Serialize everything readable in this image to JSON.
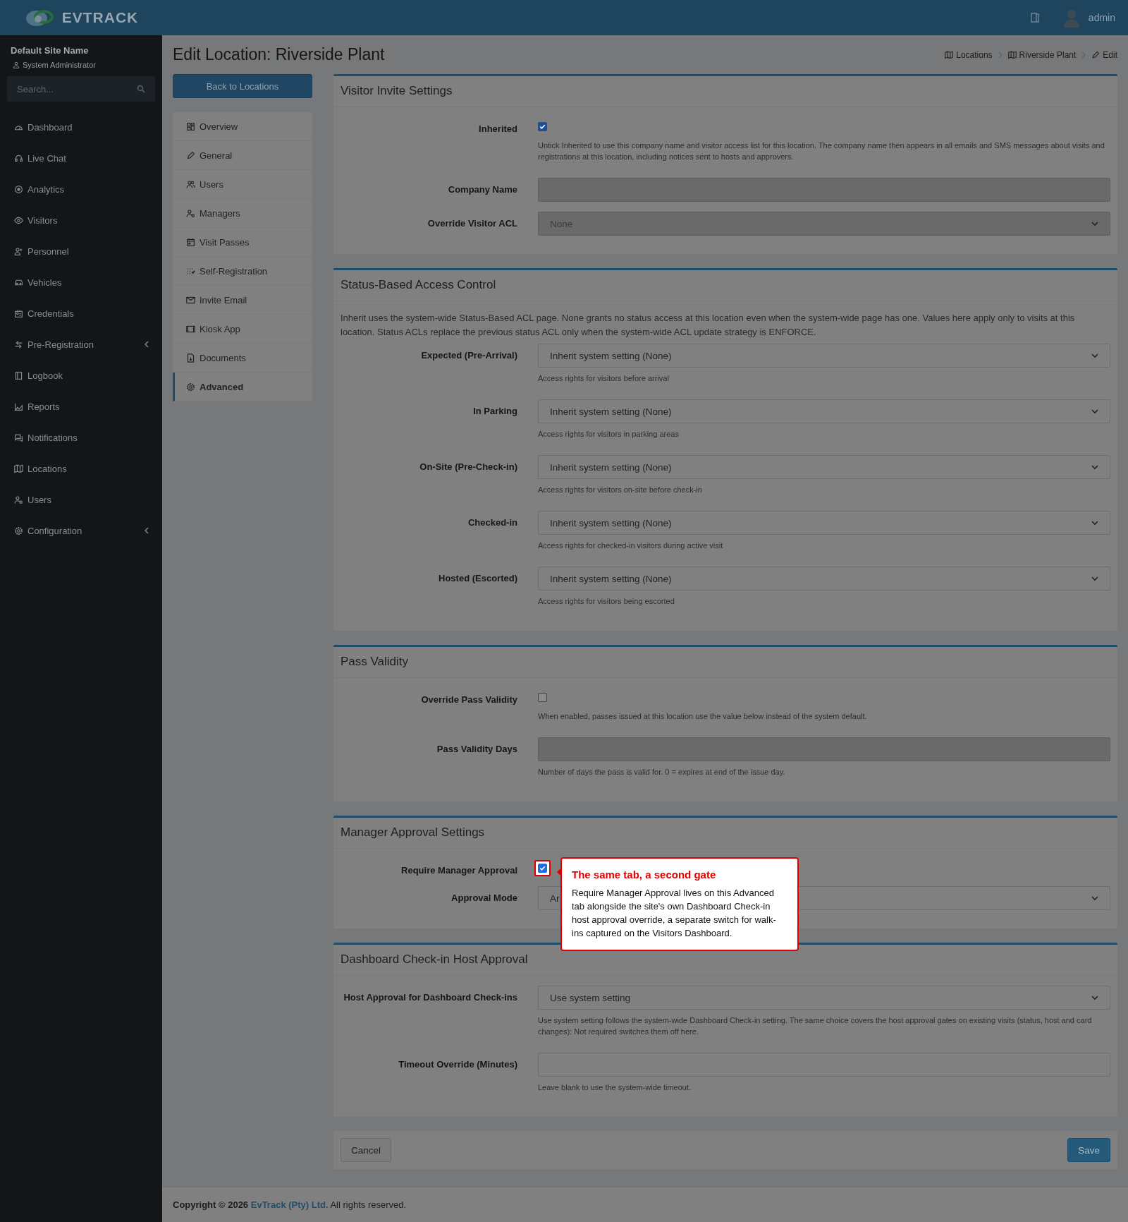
{
  "header": {
    "brand": "EVTRACK",
    "user": "admin"
  },
  "sidebar": {
    "site": "Default Site Name",
    "role": "System Administrator",
    "search": {
      "placeholder": "Search..."
    },
    "items": [
      {
        "label": "Dashboard",
        "has_submenu": false
      },
      {
        "label": "Live Chat",
        "has_submenu": false
      },
      {
        "label": "Analytics",
        "has_submenu": false
      },
      {
        "label": "Visitors",
        "has_submenu": false
      },
      {
        "label": "Personnel",
        "has_submenu": false
      },
      {
        "label": "Vehicles",
        "has_submenu": false
      },
      {
        "label": "Credentials",
        "has_submenu": false
      },
      {
        "label": "Pre-Registration",
        "has_submenu": true
      },
      {
        "label": "Logbook",
        "has_submenu": false
      },
      {
        "label": "Reports",
        "has_submenu": false
      },
      {
        "label": "Notifications",
        "has_submenu": false
      },
      {
        "label": "Locations",
        "has_submenu": false
      },
      {
        "label": "Users",
        "has_submenu": false
      },
      {
        "label": "Configuration",
        "has_submenu": true
      }
    ]
  },
  "page": {
    "title": "Edit Location: Riverside Plant",
    "breadcrumb": [
      "Locations",
      "Riverside Plant",
      "Edit"
    ]
  },
  "back_button": "Back to Locations",
  "tabs": [
    {
      "label": "Overview",
      "selected": false
    },
    {
      "label": "General",
      "selected": false
    },
    {
      "label": "Users",
      "selected": false
    },
    {
      "label": "Managers",
      "selected": false
    },
    {
      "label": "Visit Passes",
      "selected": false
    },
    {
      "label": "Self-Registration",
      "selected": false
    },
    {
      "label": "Invite Email",
      "selected": false
    },
    {
      "label": "Kiosk App",
      "selected": false
    },
    {
      "label": "Documents",
      "selected": false
    },
    {
      "label": "Advanced",
      "selected": true
    }
  ],
  "sections": [
    {
      "title": "Visitor Invite Settings",
      "fields": [
        {
          "kind": "checkbox",
          "label": "Inherited",
          "checked": true,
          "highlighted": false,
          "help": "Untick Inherited to use this company name and visitor access list for this location. The company name then appears in all emails and SMS messages about visits and registrations at this location, including notices sent to hosts and approvers."
        },
        {
          "kind": "text",
          "label": "Company Name",
          "disabled": true
        },
        {
          "kind": "select",
          "label": "Override Visitor ACL",
          "value": "None",
          "disabled": true
        }
      ]
    },
    {
      "title": "Status-Based Access Control",
      "intro": "Inherit uses the system-wide Status-Based ACL page. None grants no status access at this location even when the system-wide page has one. Values here apply only to visits at this location. Status ACLs replace the previous status ACL only when the system-wide ACL update strategy is ENFORCE.",
      "fields": [
        {
          "kind": "select",
          "label": "Expected (Pre-Arrival)",
          "value": "Inherit system setting (None)",
          "disabled": false,
          "help": "Access rights for visitors before arrival"
        },
        {
          "kind": "select",
          "label": "In Parking",
          "value": "Inherit system setting (None)",
          "disabled": false,
          "help": "Access rights for visitors in parking areas"
        },
        {
          "kind": "select",
          "label": "On-Site (Pre-Check-in)",
          "value": "Inherit system setting (None)",
          "disabled": false,
          "help": "Access rights for visitors on-site before check-in"
        },
        {
          "kind": "select",
          "label": "Checked-in",
          "value": "Inherit system setting (None)",
          "disabled": false,
          "help": "Access rights for checked-in visitors during active visit"
        },
        {
          "kind": "select",
          "label": "Hosted (Escorted)",
          "value": "Inherit system setting (None)",
          "disabled": false,
          "help": "Access rights for visitors being escorted"
        }
      ]
    },
    {
      "title": "Pass Validity",
      "fields": [
        {
          "kind": "checkbox",
          "label": "Override Pass Validity",
          "checked": false,
          "highlighted": false,
          "help": "When enabled, passes issued at this location use the value below instead of the system default."
        },
        {
          "kind": "text",
          "label": "Pass Validity Days",
          "disabled": true,
          "help": "Number of days the pass is valid for. 0 = expires at end of the issue day."
        }
      ]
    },
    {
      "title": "Manager Approval Settings",
      "fields": [
        {
          "kind": "checkbox",
          "label": "Require Manager Approval",
          "checked": true,
          "highlighted": true,
          "callout": {
            "title": "The same tab, a second gate",
            "text": "Require Manager Approval lives on this Advanced tab alongside the site's own Dashboard Check-in host approval override, a separate switch for walk-ins captured on the Visitors Dashboard."
          }
        },
        {
          "kind": "select",
          "label": "Approval Mode",
          "value": "Ar",
          "disabled": false
        }
      ]
    },
    {
      "title": "Dashboard Check-in Host Approval",
      "fields": [
        {
          "kind": "select",
          "label": "Host Approval for Dashboard Check-ins",
          "value": "Use system setting",
          "disabled": false,
          "help": "Use system setting follows the system-wide Dashboard Check-in setting. The same choice covers the host approval gates on existing visits (status, host and card changes): Not required switches them off here."
        },
        {
          "kind": "text",
          "label": "Timeout Override (Minutes)",
          "disabled": false,
          "help": "Leave blank to use the system-wide timeout."
        }
      ]
    }
  ],
  "actions": {
    "cancel": "Cancel",
    "save": "Save"
  },
  "footer": {
    "prefix": "Copyright © 2026",
    "link": "EvTrack (Pty) Ltd.",
    "suffix": "All rights reserved."
  }
}
